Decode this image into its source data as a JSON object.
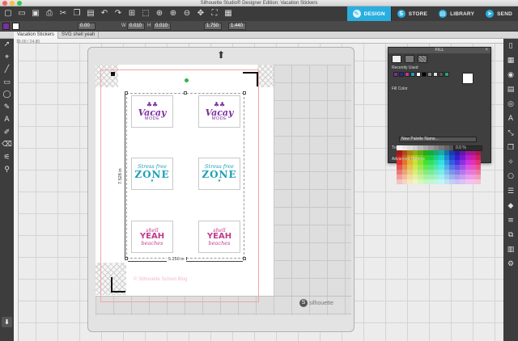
{
  "window": {
    "title": "Silhouette Studio® Designer Edition: Vacation Stickers"
  },
  "toolbar": {
    "icons": [
      "new-icon",
      "open-icon",
      "save-icon",
      "print-icon",
      "cut-icon",
      "copy-icon",
      "paste-icon",
      "undo-icon",
      "redo-icon",
      "select-all-icon",
      "select-icon",
      "zoom-icon",
      "zoom-in-icon",
      "zoom-out-icon",
      "pan-icon",
      "fit-icon",
      "grid-icon"
    ],
    "tabs": [
      {
        "label": "DESIGN",
        "icon": "design-icon"
      },
      {
        "label": "STORE",
        "icon": "store-icon"
      },
      {
        "label": "LIBRARY",
        "icon": "library-icon"
      },
      {
        "label": "SEND",
        "icon": "send-icon"
      }
    ]
  },
  "properties": {
    "line_width": "0.00",
    "width_label": "W",
    "w": "0.010",
    "h_label": "H",
    "h": "0.010",
    "size_w": "1.750",
    "size_h": "1.440"
  },
  "documents": [
    {
      "name": "Vacation Stickers",
      "active": true
    },
    {
      "name": "SVG shell yeah",
      "active": false
    }
  ],
  "canvas": {
    "zoom": "19.00 / 24.80",
    "dim_width": "5.250 in",
    "dim_height": "7.528 in",
    "watermark": "© Silhouette School Blog",
    "logo_text": "silhouette"
  },
  "stickers": [
    {
      "type": "vacay",
      "big": "Vacay",
      "small": "MODE"
    },
    {
      "type": "vacay",
      "big": "Vacay",
      "small": "MODE"
    },
    {
      "type": "zone",
      "top": "Stress free",
      "big": "ZONE"
    },
    {
      "type": "zone",
      "top": "Stress free",
      "big": "ZONE"
    },
    {
      "type": "shell",
      "top": "shell",
      "big": "YEAH",
      "bot": "beaches"
    },
    {
      "type": "shell",
      "top": "shell",
      "big": "YEAH",
      "bot": "beaches"
    }
  ],
  "fill_panel": {
    "title": "FILL",
    "recently_used": "Recently Used",
    "fill_color": "Fill Color",
    "new_palette": "New Palette Name...",
    "transparency_label": "Transparency",
    "transparency_value": "0.0 %",
    "advanced": "Advanced Options"
  },
  "colors": {
    "accent": "#29aee0",
    "vacay": "#7b2fa0",
    "zone": "#1aa0b8",
    "shell": "#c23a8c"
  }
}
